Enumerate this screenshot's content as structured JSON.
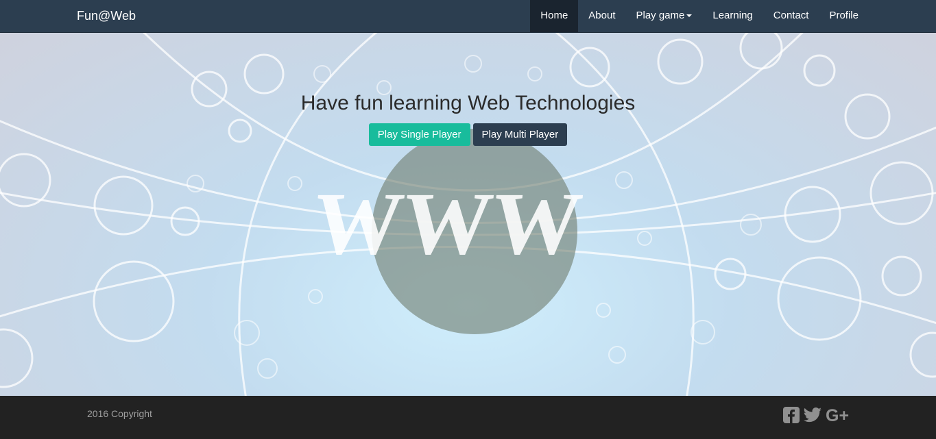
{
  "navbar": {
    "brand": "Fun@Web",
    "items": [
      {
        "label": "Home",
        "active": true
      },
      {
        "label": "About"
      },
      {
        "label": "Play game",
        "dropdown": true
      },
      {
        "label": "Learning"
      },
      {
        "label": "Contact"
      },
      {
        "label": "Profile"
      }
    ]
  },
  "hero": {
    "title": "Have fun learning Web Technologies",
    "buttons": {
      "single": "Play Single Player",
      "multi": "Play Multi Player"
    },
    "image_text": "WWW"
  },
  "footer": {
    "copyright": "2016 Copyright",
    "social_icons": [
      "facebook-square-icon",
      "twitter-icon",
      "google-plus-icon"
    ]
  },
  "colors": {
    "navbar": "#2c3e50",
    "nav_active": "#1a242f",
    "accent": "#18bc9c",
    "footer": "#222222"
  }
}
